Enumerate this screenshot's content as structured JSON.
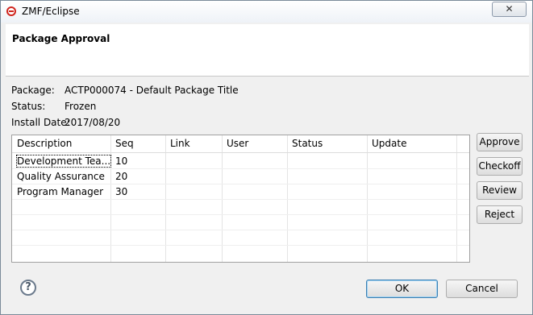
{
  "window": {
    "title": "ZMF/Eclipse",
    "close_glyph": "✕"
  },
  "header": {
    "title": "Package Approval"
  },
  "info": {
    "package_label": "Package:",
    "package_value": "ACTP000074 - Default Package Title",
    "status_label": "Status:",
    "status_value": "Frozen",
    "install_label": "Install Date:",
    "install_value": "2017/08/20"
  },
  "table": {
    "columns": [
      "Description",
      "Seq",
      "Link",
      "User",
      "Status",
      "Update"
    ],
    "rows": [
      {
        "description": "Development Tea...",
        "seq": "10"
      },
      {
        "description": "Quality Assurance",
        "seq": "20"
      },
      {
        "description": "Program Manager",
        "seq": "30"
      }
    ]
  },
  "side_buttons": {
    "approve": "Approve",
    "checkoff": "Checkoff",
    "review": "Review",
    "reject": "Reject"
  },
  "footer": {
    "help_glyph": "?",
    "ok": "OK",
    "cancel": "Cancel"
  }
}
